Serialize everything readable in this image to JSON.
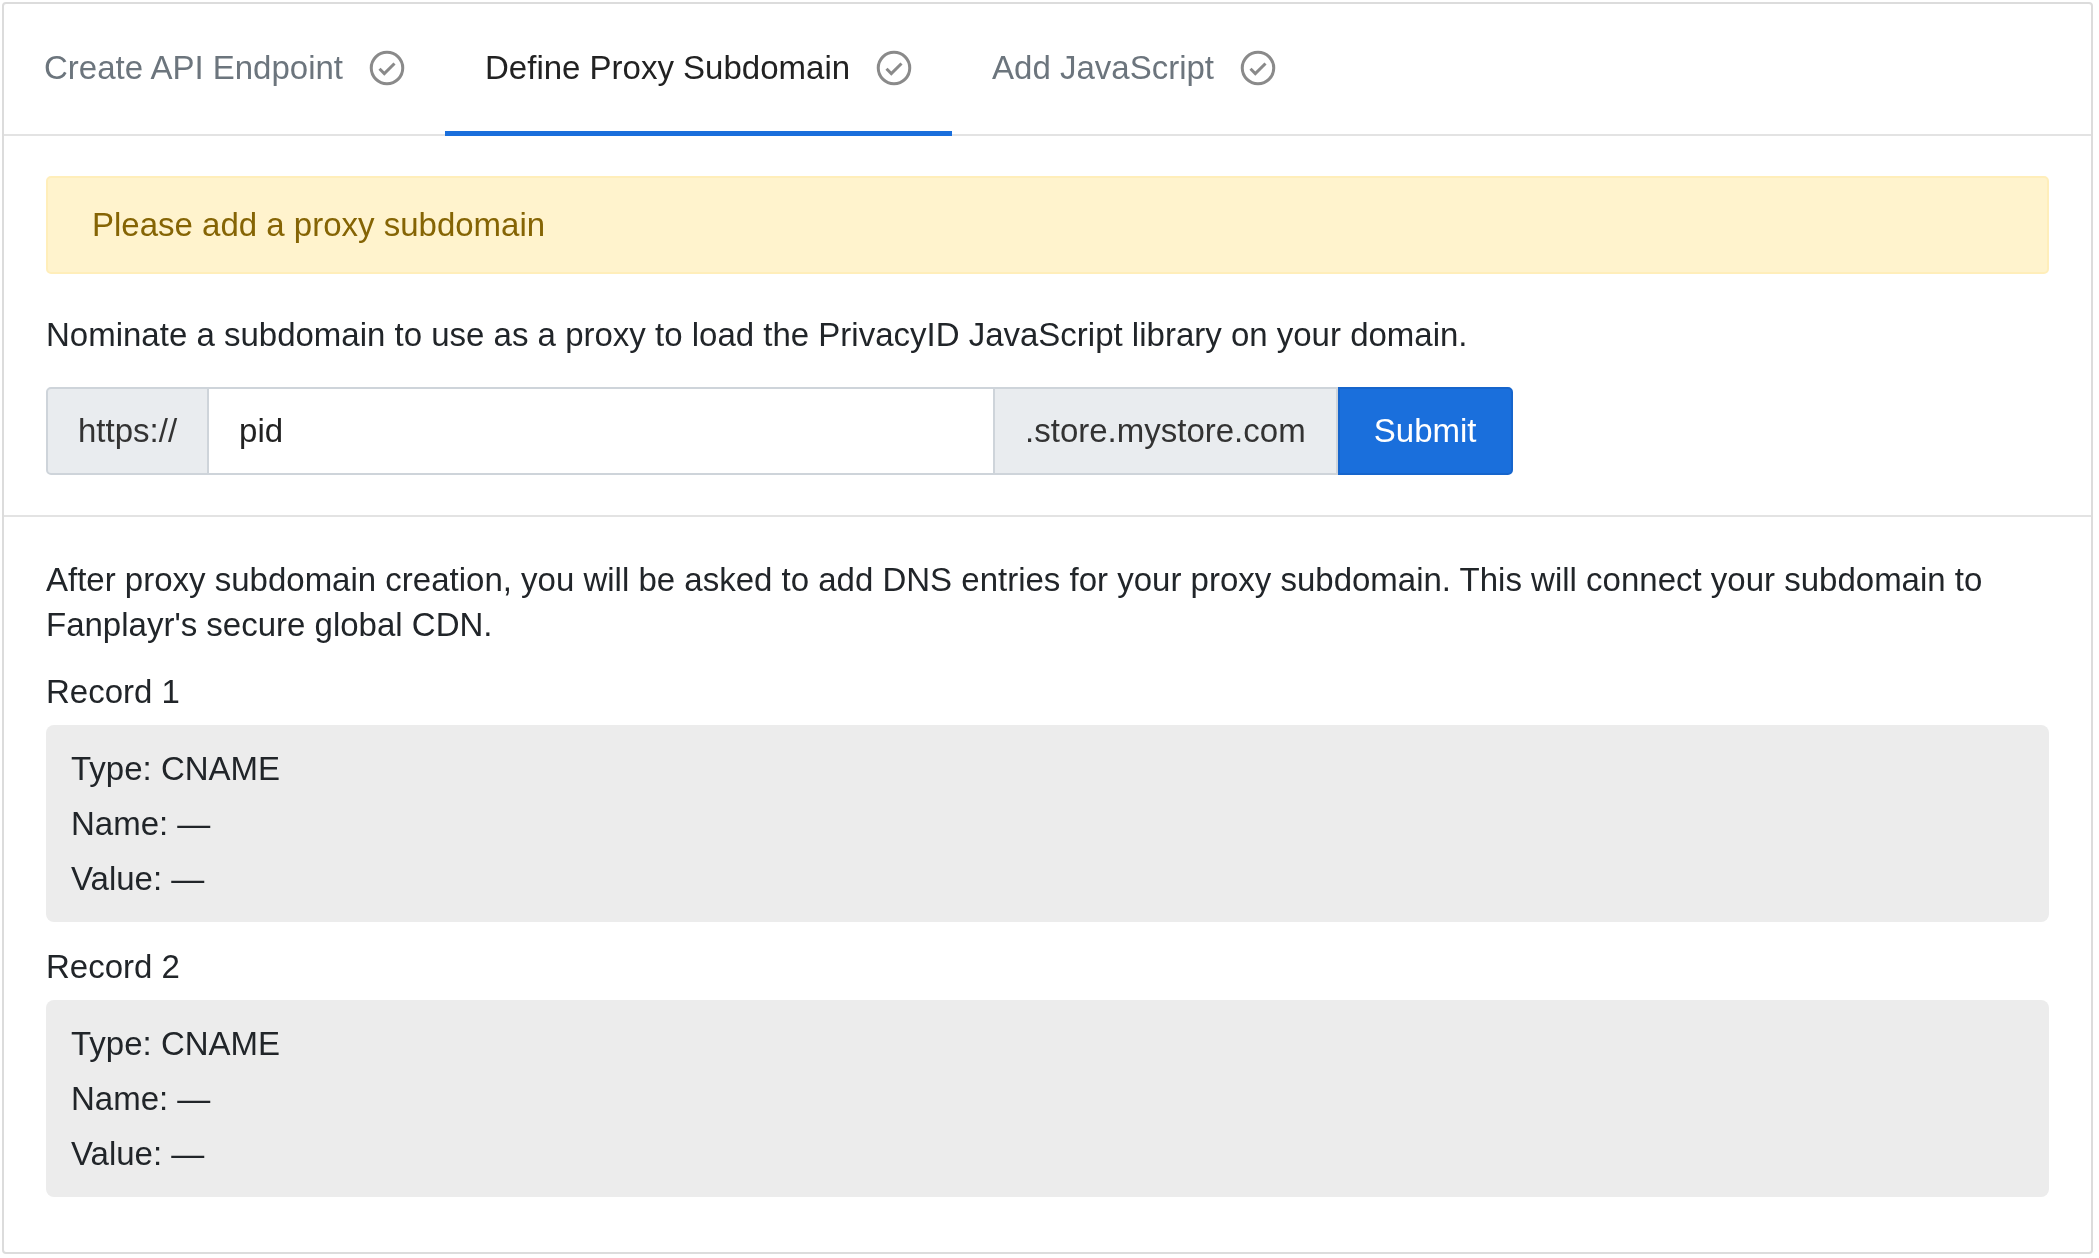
{
  "tabs": [
    {
      "label": "Create API Endpoint",
      "selected": false
    },
    {
      "label": "Define Proxy Subdomain",
      "selected": true
    },
    {
      "label": "Add JavaScript",
      "selected": false
    }
  ],
  "alert": "Please add a proxy subdomain",
  "intro": "Nominate a subdomain to use as a proxy to load the PrivacyID JavaScript library on your domain.",
  "subdomain_form": {
    "prefix": "https://",
    "value": "pid",
    "suffix": ".store.mystore.com",
    "button": "Submit"
  },
  "dns_note": "After proxy subdomain creation, you will be asked to add DNS entries for your proxy subdomain. This will connect your subdomain to Fanplayr's secure global CDN.",
  "records": [
    {
      "title": "Record 1",
      "lines": [
        "Type: CNAME",
        "Name: —",
        "Value: —"
      ]
    },
    {
      "title": "Record 2",
      "lines": [
        "Type: CNAME",
        "Name: —",
        "Value: —"
      ]
    }
  ]
}
